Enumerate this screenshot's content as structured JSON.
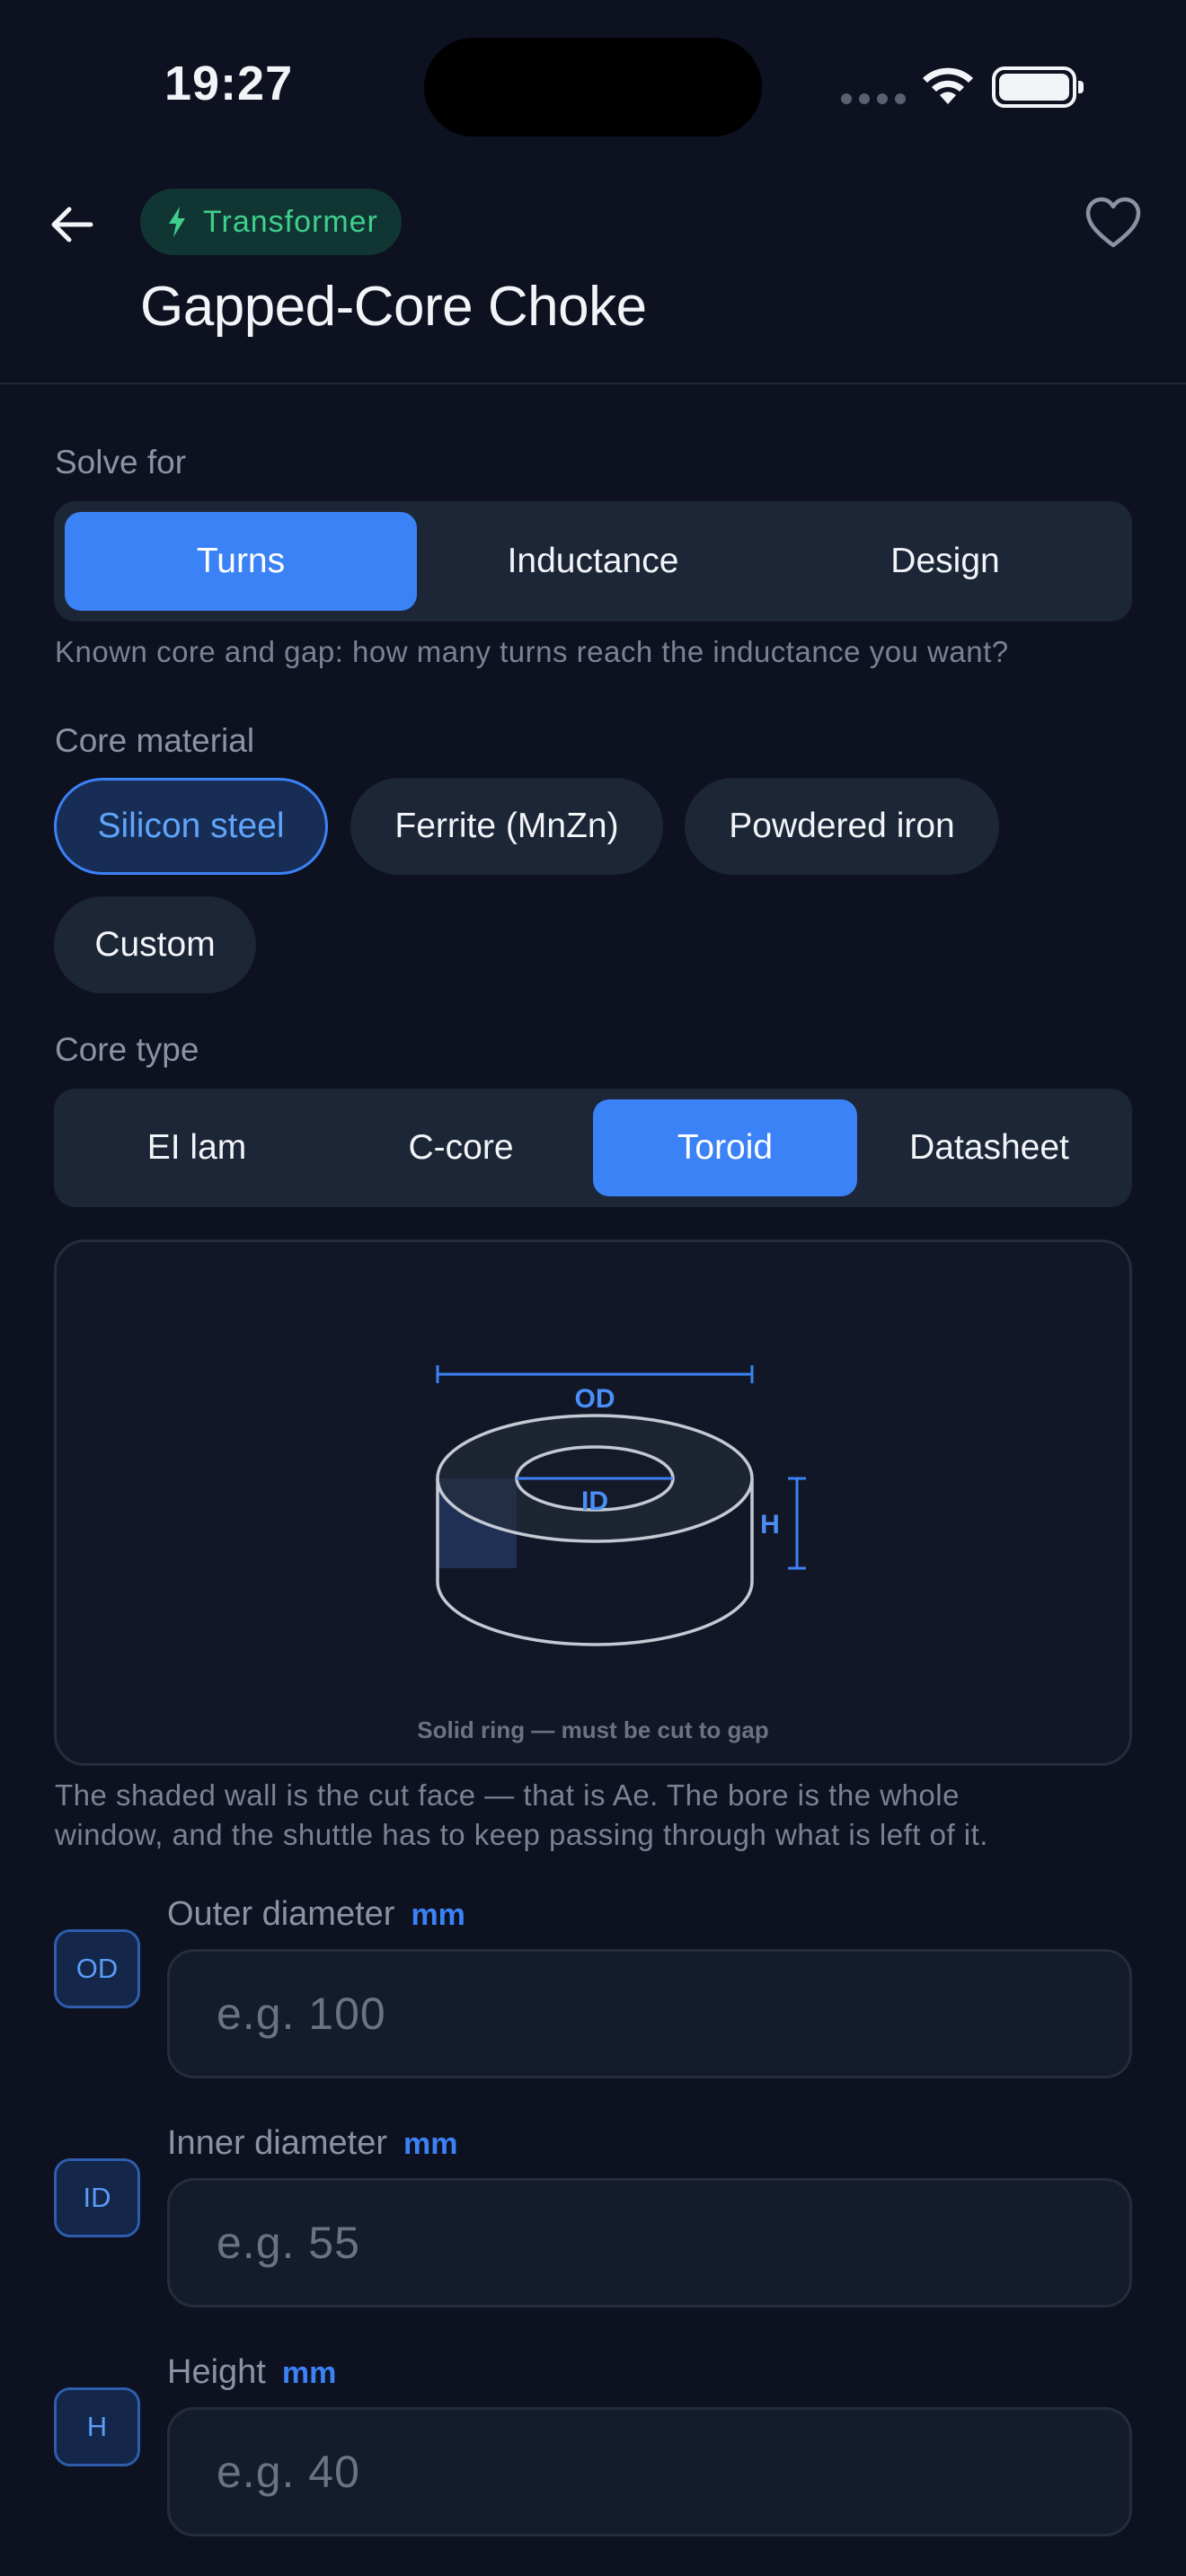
{
  "status_bar": {
    "time": "19:27"
  },
  "header": {
    "category": "Transformer",
    "title": "Gapped-Core Choke"
  },
  "solve_for": {
    "label": "Solve for",
    "options": [
      "Turns",
      "Inductance",
      "Design"
    ],
    "selected": "Turns",
    "hint": "Known core and gap: how many turns reach the inductance you want?"
  },
  "core_material": {
    "label": "Core material",
    "options": [
      "Silicon steel",
      "Ferrite (MnZn)",
      "Powdered iron",
      "Custom"
    ],
    "selected": "Silicon steel"
  },
  "core_type": {
    "label": "Core type",
    "options": [
      "EI lam",
      "C-core",
      "Toroid",
      "Datasheet"
    ],
    "selected": "Toroid"
  },
  "diagram": {
    "labels": {
      "od": "OD",
      "id": "ID",
      "h": "H"
    },
    "caption": "Solid ring — must be cut to gap",
    "description_line1": "The shaded wall is the cut face — that is Ae. The bore is the whole",
    "description_line2": "window, and the shuttle has to keep passing through what is left of it."
  },
  "fields": [
    {
      "badge": "OD",
      "label": "Outer diameter",
      "unit": "mm",
      "placeholder": "e.g. 100",
      "value": ""
    },
    {
      "badge": "ID",
      "label": "Inner diameter",
      "unit": "mm",
      "placeholder": "e.g. 55",
      "value": ""
    },
    {
      "badge": "H",
      "label": "Height",
      "unit": "mm",
      "placeholder": "e.g. 40",
      "value": ""
    }
  ],
  "colors": {
    "background": "#0d1120",
    "accent": "#3b82f6",
    "category_green": "#3ecf8e",
    "surface": "#1c2637"
  }
}
